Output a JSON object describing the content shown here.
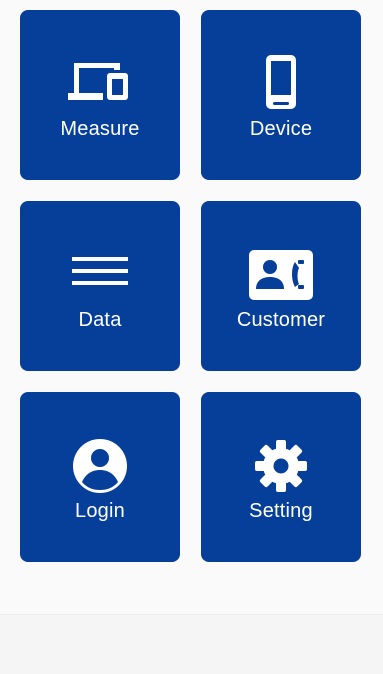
{
  "colors": {
    "tile_background": "#063f99",
    "tile_text": "#ffffff",
    "page_background": "#fafafa"
  },
  "menu": {
    "tiles": [
      {
        "label": "Measure",
        "icon": "devices-icon"
      },
      {
        "label": "Device",
        "icon": "smartphone-icon"
      },
      {
        "label": "Data",
        "icon": "list-lines-icon"
      },
      {
        "label": "Customer",
        "icon": "contact-phone-icon"
      },
      {
        "label": "Login",
        "icon": "account-circle-icon"
      },
      {
        "label": "Setting",
        "icon": "gear-icon"
      }
    ]
  }
}
